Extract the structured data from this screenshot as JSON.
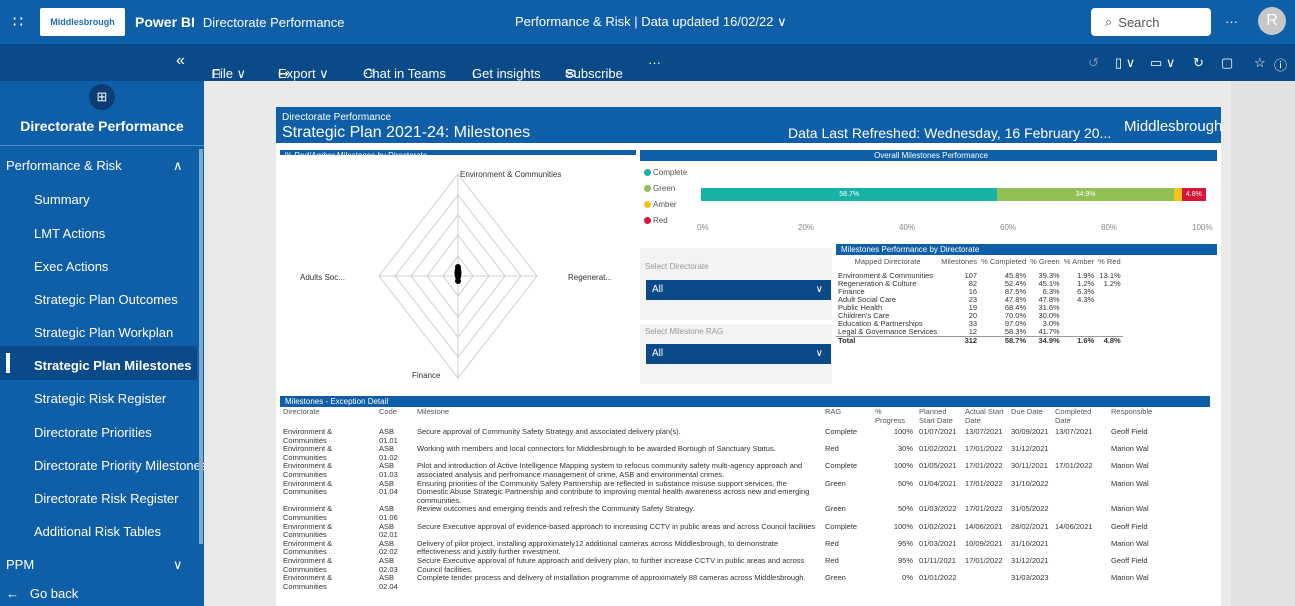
{
  "topbar": {
    "app": "Power BI",
    "report": "Directorate Performance",
    "center": "Performance & Risk |   Data updated 16/02/22 ∨",
    "search_placeholder": "Search",
    "logo_text": "Middlesbrough",
    "avatar_initial": "R",
    "more": "···"
  },
  "toolbar": {
    "collapse": "«",
    "file": "File ∨",
    "export": "Export ∨",
    "chat": "Chat in Teams",
    "insights": "Get insights",
    "subscribe": "Subscribe",
    "more": "···"
  },
  "sidebar": {
    "title": "Directorate Performance",
    "section": "Performance & Risk",
    "items": [
      "Summary",
      "LMT Actions",
      "Exec Actions",
      "Strategic Plan Outcomes",
      "Strategic Plan Workplan",
      "Strategic Plan Milestones",
      "Strategic Risk Register",
      "Directorate Priorities",
      "Directorate Priority Milestones",
      "Directorate Risk Register",
      "Additional Risk Tables"
    ],
    "ppm": "PPM",
    "back": "Go back"
  },
  "report": {
    "subtitle": "Directorate Performance",
    "title": "Strategic Plan 2021-24: Milestones",
    "refreshed": "Data Last Refreshed: Wednesday, 16 February 20...",
    "logo": "Middlesbrough",
    "radar": {
      "title": "% Red/Amber Milestones by Directorate",
      "labels": {
        "top": "Environment & Communities",
        "left": "Adults Soc...",
        "right": "Regenerat...",
        "bottom": "Finance"
      }
    },
    "overall": {
      "title": "Overall Milestones Performance",
      "legend": [
        "Complete",
        "Green",
        "Amber",
        "Red"
      ],
      "colors": {
        "complete": "#17b2a6",
        "green": "#93c055",
        "amber": "#f6c21c",
        "red": "#d6163a"
      },
      "bar": {
        "complete": 58.7,
        "green": 34.9,
        "amber": 1.6,
        "red": 4.8
      },
      "bar_labels": [
        "58.7%",
        "34.9%",
        "4.8%"
      ],
      "ticks": [
        "0%",
        "20%",
        "40%",
        "60%",
        "80%",
        "100%"
      ]
    },
    "filters": {
      "directorate_label": "Select Directorate",
      "directorate_value": "All",
      "rag_label": "Select Milestone RAG",
      "rag_value": "All"
    },
    "directorate_table": {
      "title": "Milestones Performance by Directorate",
      "headers": [
        "Mapped Directorate",
        "Milestones",
        "% Completed",
        "% Green",
        "% Amber",
        "% Red"
      ],
      "rows": [
        [
          "Environment & Communities",
          "107",
          "45.8%",
          "39.3%",
          "1.9%",
          "13.1%"
        ],
        [
          "Regeneration & Culture",
          "82",
          "52.4%",
          "45.1%",
          "1.2%",
          "1.2%"
        ],
        [
          "Finance",
          "16",
          "87.5%",
          "6.3%",
          "6.3%",
          ""
        ],
        [
          "Adult Social Care",
          "23",
          "47.8%",
          "47.8%",
          "4.3%",
          ""
        ],
        [
          "Public Health",
          "19",
          "68.4%",
          "31.6%",
          "",
          ""
        ],
        [
          "Children's Care",
          "20",
          "70.0%",
          "30.0%",
          "",
          ""
        ],
        [
          "Education & Partnerships",
          "33",
          "97.0%",
          "3.0%",
          "",
          ""
        ],
        [
          "Legal & Governance Services",
          "12",
          "58.3%",
          "41.7%",
          "",
          ""
        ]
      ],
      "total": [
        "Total",
        "312",
        "58.7%",
        "34.9%",
        "1.6%",
        "4.8%"
      ]
    },
    "exceptions": {
      "title": "Milestones - Exception Detail",
      "headers": [
        "Directorate",
        "Code",
        "Milestone",
        "RAG",
        "% Progress",
        "Planned Start Date",
        "Actual Start Date",
        "Due Date",
        "Completed Date",
        "Responsible"
      ],
      "rows": [
        [
          "Environment & Communities",
          "ASB 01.01",
          "Secure approval of Community Safety Strategy and associated delivery plan(s).",
          "Complete",
          "100%",
          "01/07/2021",
          "13/07/2021",
          "30/09/2021",
          "13/07/2021",
          "Geoff Field"
        ],
        [
          "Environment & Communities",
          "ASB 01.02",
          "Working with members and local connectors for Middlesbrough to be awarded Borough of Sanctuary Status.",
          "Red",
          "30%",
          "01/02/2021",
          "17/01/2022",
          "31/12/2021",
          "",
          "Marion Wal"
        ],
        [
          "Environment & Communities",
          "ASB 01.03",
          "Pilot and introduction of Active Intelligence Mapping system to refocus community safety multi-agency approach and associated analysis and perfromance management of crime, ASB and environmental crimes.",
          "Complete",
          "100%",
          "01/05/2021",
          "17/01/2022",
          "30/11/2021",
          "17/01/2022",
          "Marion Wal"
        ],
        [
          "Environment & Communities",
          "ASB 01.04",
          "Ensuring priorities of the Community Safety Partnership are reflected in substance misuse support services, the Domestic Abuse Strategic Partnership and contribute to improving mental health awareness across new and emerging communities.",
          "Green",
          "50%",
          "01/04/2021",
          "17/01/2022",
          "31/10/2022",
          "",
          "Marion Wal"
        ],
        [
          "Environment & Communities",
          "ASB 01.06",
          "Review outcomes and emerging trends and refresh the Community Safety Strategy.",
          "Green",
          "50%",
          "01/03/2022",
          "17/01/2022",
          "31/05/2022",
          "",
          "Marion Wal"
        ],
        [
          "Environment & Communities",
          "ASB 02.01",
          "Secure Executive approval of evidence-based approach to increasing CCTV in public areas and across Council facilities",
          "Complete",
          "100%",
          "01/02/2021",
          "14/06/2021",
          "28/02/2021",
          "14/06/2021",
          "Geoff Field"
        ],
        [
          "Environment & Communities",
          "ASB 02.02",
          "Delivery of pilot project, installing approximately12 additional cameras across Middlesbrough, to demonstrate effectiveness and justify further investment.",
          "Red",
          "95%",
          "01/03/2021",
          "10/09/2021",
          "31/10/2021",
          "",
          "Marion Wal"
        ],
        [
          "Environment & Communities",
          "ASB 02.03",
          "Secure Executive approval of future approach and delivery plan, to further increase CCTV in public areas and across Council facilities.",
          "Red",
          "95%",
          "01/11/2021",
          "17/01/2022",
          "31/12/2021",
          "",
          "Geoff Field"
        ],
        [
          "Environment & Communities",
          "ASB 02.04",
          "Complete tender process and delivery of installation programme of approximately 88 cameras across Middlesbrough.",
          "Green",
          "0%",
          "01/01/2022",
          "",
          "31/03/2023",
          "",
          "Marion Wal"
        ]
      ]
    }
  }
}
